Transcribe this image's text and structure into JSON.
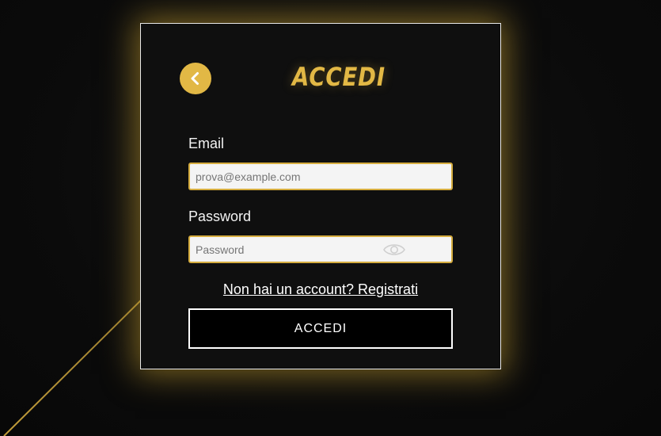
{
  "login": {
    "title": "ACCEDI",
    "back_icon": "chevron-left-icon",
    "email": {
      "label": "Email",
      "placeholder": "prova@example.com",
      "value": ""
    },
    "password": {
      "label": "Password",
      "placeholder": "Password",
      "value": "",
      "toggle_icon": "eye-icon"
    },
    "register_link": "Non hai un account? Registrati",
    "submit_label": "ACCEDI"
  },
  "colors": {
    "accent": "#e2b845",
    "background": "#0b0b0b",
    "card_background": "#0f0f0f",
    "card_border": "#e8e8e8",
    "input_background": "#f4f4f4",
    "button_background": "#000000",
    "text": "#ffffff"
  }
}
